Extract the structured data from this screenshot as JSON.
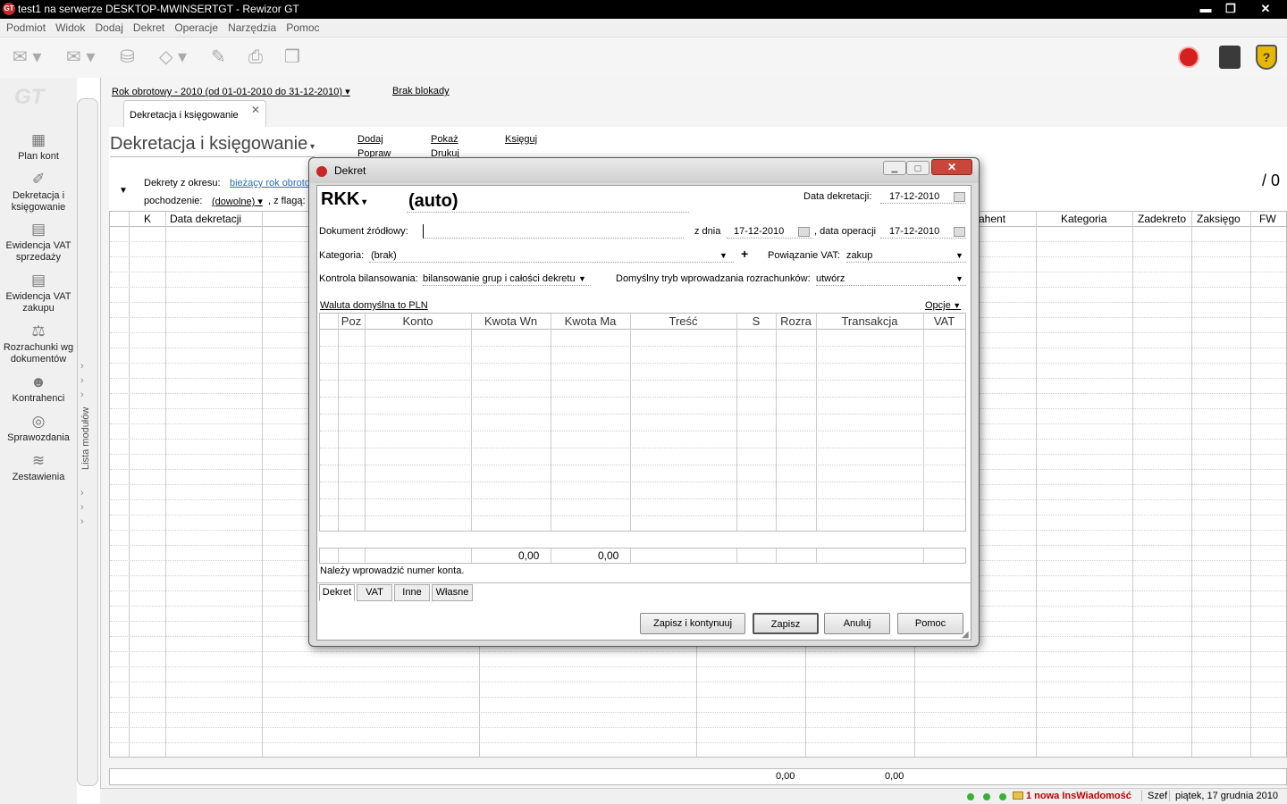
{
  "window": {
    "title": "test1 na serwerze DESKTOP-MWINSERTGT - Rewizor GT",
    "app_icon": "GT",
    "minimize": "▬",
    "maximize": "❐",
    "close": "✕"
  },
  "menu": [
    "Podmiot",
    "Widok",
    "Dodaj",
    "Dekret",
    "Operacje",
    "Narzędzia",
    "Pomoc"
  ],
  "sidebar": {
    "logo": "GT",
    "items": [
      "Plan kont",
      "Dekretacja i księgowanie",
      "Ewidencja VAT sprzedaży",
      "Ewidencja VAT zakupu",
      "Rozrachunki wg dokumentów",
      "Kontrahenci",
      "Sprawozdania",
      "Zestawienia"
    ],
    "module_list_label": "Lista modułów"
  },
  "context": {
    "fiscal_year": "Rok obrotowy - 2010  (od 01-01-2010 do 31-12-2010)",
    "lock_status": "Brak blokady"
  },
  "tab": {
    "label": "Dekretacja i księgowanie",
    "close": "✕"
  },
  "page": {
    "title": "Dekretacja i księgowanie",
    "actions": {
      "add": "Dodaj",
      "edit": "Popraw",
      "show": "Pokaż",
      "print": "Drukuj",
      "post": "Księguj"
    },
    "page_counter": "/ 0"
  },
  "filters": {
    "period_label": "Dekrety z okresu:",
    "period_value": "bieżący rok obroto",
    "origin_label": "pochodzenie:",
    "origin_value": "(dowolne)",
    "flag_label": ", z flagą:"
  },
  "grid": {
    "columns": [
      "K",
      "Data dekretacji",
      "ahent",
      "Kategoria",
      "Zadekreto",
      "Zaksięgo",
      "FW"
    ],
    "totals": [
      "0,00",
      "0,00"
    ]
  },
  "status": {
    "message": "1 nowa InsWiadomość",
    "user": "Szef",
    "date": "piątek, 17 grudnia 2010"
  },
  "dialog": {
    "title": "Dekret",
    "close": "✕",
    "journal": "RKK",
    "number": "(auto)",
    "date_label": "Data dekretacji:",
    "date_value": "17-12-2010",
    "source_doc_label": "Dokument źródłowy:",
    "source_doc_value": "",
    "of_date_label": "z dnia",
    "of_date_value": "17-12-2010",
    "op_date_label": ", data operacji",
    "op_date_value": "17-12-2010",
    "category_label": "Kategoria:",
    "category_value": "(brak)",
    "add": "+",
    "vat_link_label": "Powiązanie VAT:",
    "vat_link_value": "zakup",
    "balance_label": "Kontrola bilansowania:",
    "balance_value": "bilansowanie grup i całości dekretu",
    "settle_label": "Domyślny tryb wprowadzania rozrachunków:",
    "settle_value": "utwórz",
    "currency_note": "Waluta domyślna to PLN",
    "options": "Opcje",
    "columns": [
      "Poz",
      "Konto",
      "Kwota Wn",
      "Kwota Ma",
      "Treść",
      "S",
      "Rozra",
      "Transakcja",
      "VAT"
    ],
    "totals": {
      "wn": "0,00",
      "ma": "0,00"
    },
    "message": "Należy wprowadzić numer konta.",
    "tabs": [
      "Dekret",
      "VAT",
      "Inne",
      "Własne"
    ],
    "buttons": {
      "save_continue": "Zapisz i kontynuuj",
      "save": "Zapisz",
      "cancel": "Anuluj",
      "help": "Pomoc"
    }
  }
}
